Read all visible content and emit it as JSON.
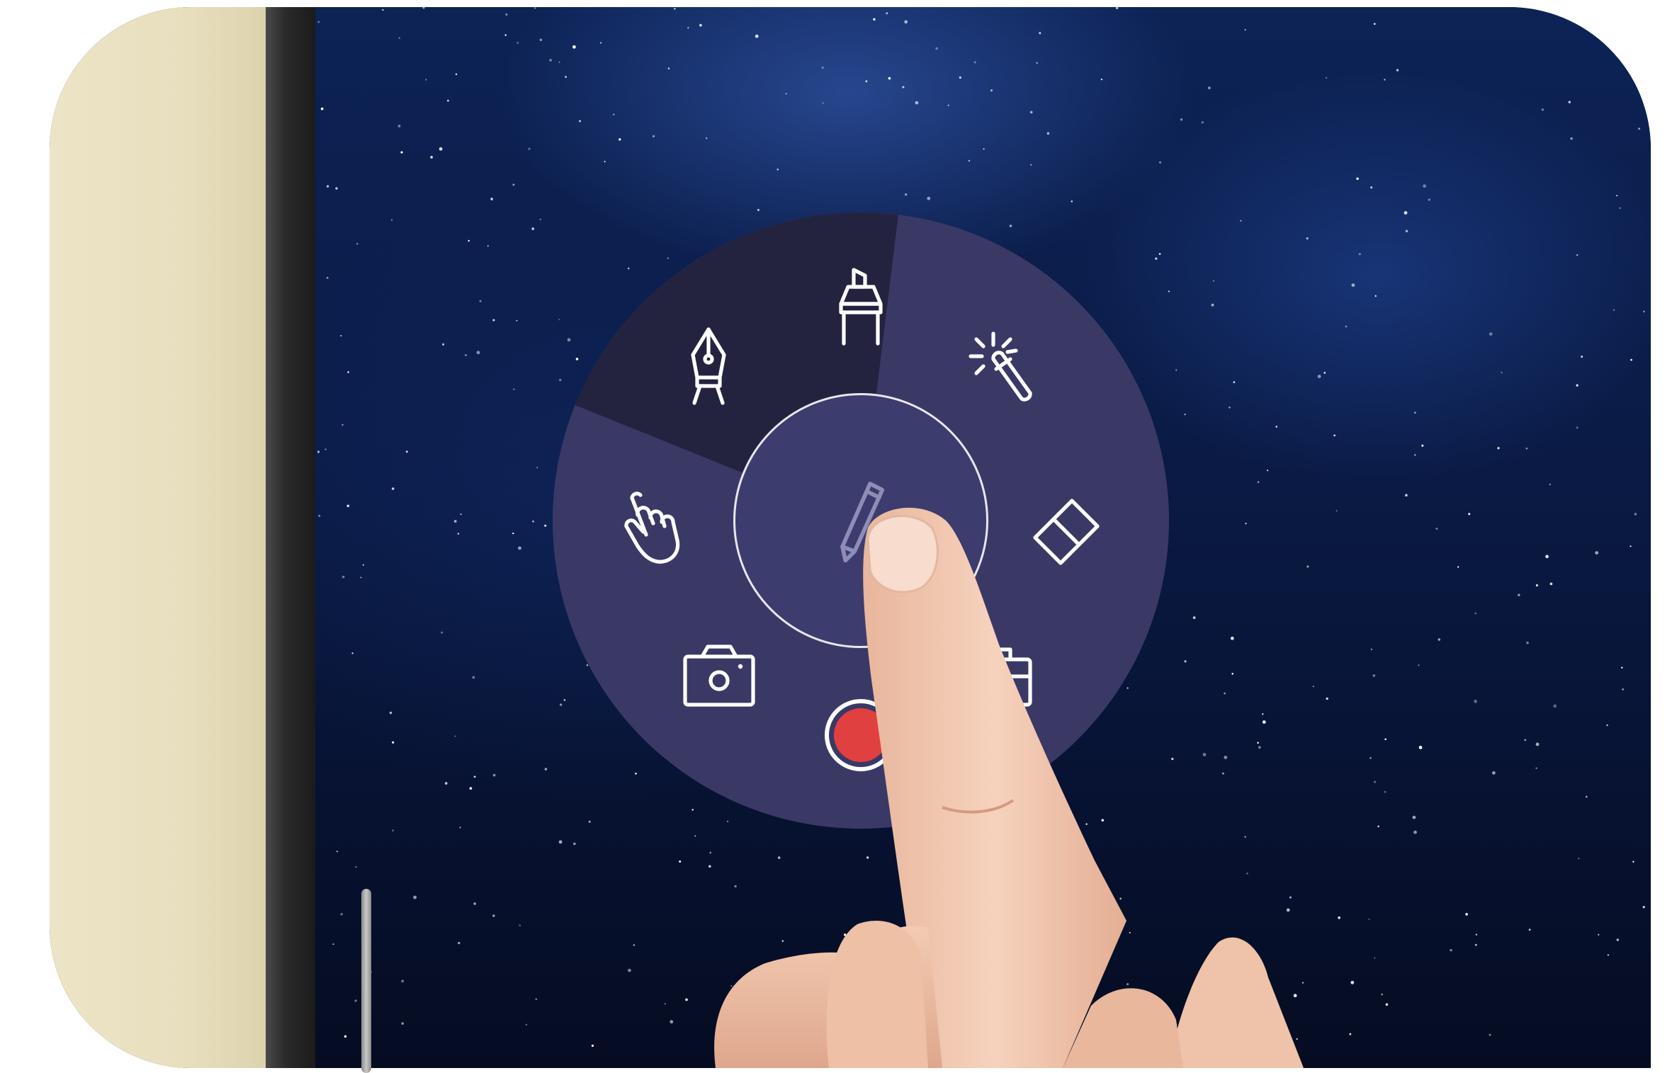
{
  "colors": {
    "menu_background": "#3a3966",
    "menu_selected_segment": "#24233f",
    "icon_stroke": "#ffffff",
    "record_dot": "#e0403f",
    "wall": "#ece4c6"
  },
  "radial_menu": {
    "selected_tool": "pen-tool",
    "tools": [
      {
        "icon": "fountain-pen-icon",
        "selected": true
      },
      {
        "icon": "highlighter-icon",
        "selected": false
      },
      {
        "icon": "magic-wand-icon",
        "selected": false
      },
      {
        "icon": "eraser-icon",
        "selected": false
      },
      {
        "icon": "toolbox-icon",
        "selected": false
      },
      {
        "icon": "record-icon",
        "selected": false
      },
      {
        "icon": "camera-icon",
        "selected": false
      },
      {
        "icon": "hand-pointer-icon",
        "selected": false
      }
    ],
    "center_icon": "pencil-icon"
  }
}
